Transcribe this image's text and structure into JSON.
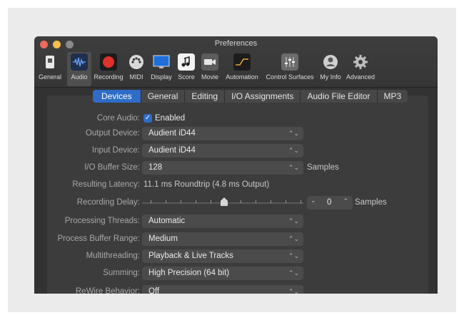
{
  "window": {
    "title": "Preferences"
  },
  "toolbar": {
    "items": [
      {
        "label": "General",
        "icon": "general-icon"
      },
      {
        "label": "Audio",
        "icon": "audio-waveform-icon",
        "selected": true
      },
      {
        "label": "Recording",
        "icon": "record-icon"
      },
      {
        "label": "MIDI",
        "icon": "midi-icon"
      },
      {
        "label": "Display",
        "icon": "display-icon"
      },
      {
        "label": "Score",
        "icon": "score-icon"
      },
      {
        "label": "Movie",
        "icon": "movie-icon"
      },
      {
        "label": "Automation",
        "icon": "automation-icon"
      },
      {
        "label": "Control Surfaces",
        "icon": "control-surfaces-icon"
      },
      {
        "label": "My Info",
        "icon": "my-info-icon"
      },
      {
        "label": "Advanced",
        "icon": "gear-icon"
      }
    ]
  },
  "subtabs": [
    "Devices",
    "General",
    "Editing",
    "I/O Assignments",
    "Audio File Editor",
    "MP3"
  ],
  "settings": {
    "core_audio": {
      "label": "Core Audio:",
      "value": "Enabled",
      "checked": true
    },
    "output_device": {
      "label": "Output Device:",
      "value": "Audient iD44"
    },
    "input_device": {
      "label": "Input Device:",
      "value": "Audient iD44"
    },
    "io_buffer": {
      "label": "I/O Buffer Size:",
      "value": "128",
      "suffix": "Samples"
    },
    "resulting_latency": {
      "label": "Resulting Latency:",
      "value": "11.1 ms Roundtrip (4.8 ms Output)"
    },
    "recording_delay": {
      "label": "Recording Delay:",
      "value": "0",
      "suffix": "Samples",
      "slider_fraction": 0.5
    },
    "processing_threads": {
      "label": "Processing Threads:",
      "value": "Automatic"
    },
    "process_buffer_range": {
      "label": "Process Buffer Range:",
      "value": "Medium"
    },
    "multithreading": {
      "label": "Multithreading:",
      "value": "Playback & Live Tracks"
    },
    "summing": {
      "label": "Summing:",
      "value": "High Precision (64 bit)"
    },
    "rewire": {
      "label": "ReWire Behavior:",
      "value": "Off"
    }
  },
  "colors": {
    "accent": "#2f6cc7",
    "record": "#e0312b"
  }
}
